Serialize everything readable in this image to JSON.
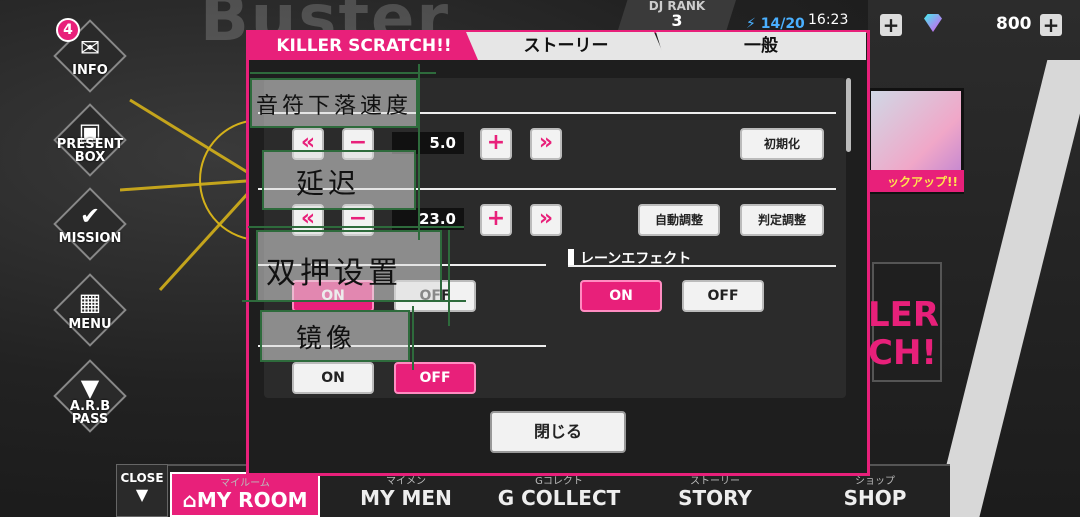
{
  "background": {
    "title_text": "Buster"
  },
  "side_menu": {
    "info": {
      "label": "INFO",
      "badge": "4"
    },
    "present": {
      "label": "PRESENT\nBOX"
    },
    "mission": {
      "label": "MISSION"
    },
    "menu": {
      "label": "MENU"
    },
    "arb": {
      "label": "A.R.B\nPASS"
    }
  },
  "status": {
    "dj_rank_label": "DJ RANK",
    "dj_rank_value": "3",
    "stamina": "14/20",
    "time": "16:23",
    "gems": "800"
  },
  "tabs": [
    {
      "label": "KILLER SCRATCH!!",
      "active": true
    },
    {
      "label": "ストーリー",
      "active": false
    },
    {
      "label": "一般",
      "active": false
    }
  ],
  "settings": {
    "speed": {
      "annotation": "音符下落速度",
      "value": "5.0",
      "reset_label": "初期化",
      "dec_fast": "«",
      "dec": "−",
      "inc": "+",
      "inc_fast": "»"
    },
    "delay": {
      "annotation": "延迟",
      "value": "23.0",
      "auto_label": "自動調整",
      "judge_label": "判定調整",
      "dec_fast": "«",
      "dec": "−",
      "inc": "+",
      "inc_fast": "»"
    },
    "double": {
      "annotation": "双押设置",
      "on_label": "ON",
      "off_label": "OFF"
    },
    "lane_effect": {
      "title": "レーンエフェクト",
      "on_label": "ON",
      "off_label": "OFF"
    },
    "mirror": {
      "annotation": "镜像",
      "on_label": "ON",
      "off_label": "OFF"
    }
  },
  "close_label": "閉じる",
  "bottom_nav": {
    "close": "CLOSE",
    "items": [
      {
        "sub": "マイルーム",
        "label": "MY ROOM"
      },
      {
        "sub": "マイメン",
        "label": "MY MEN"
      },
      {
        "sub": "Gコレクト",
        "label": "G COLLECT"
      },
      {
        "sub": "ストーリー",
        "label": "STORY"
      },
      {
        "sub": "ショップ",
        "label": "SHOP"
      }
    ]
  },
  "background_card": {
    "label": "ックアップ!!",
    "killer_text": "LER\nCH!!"
  },
  "colors": {
    "accent": "#e8207a",
    "annotation_border": "#2e6b3c"
  }
}
